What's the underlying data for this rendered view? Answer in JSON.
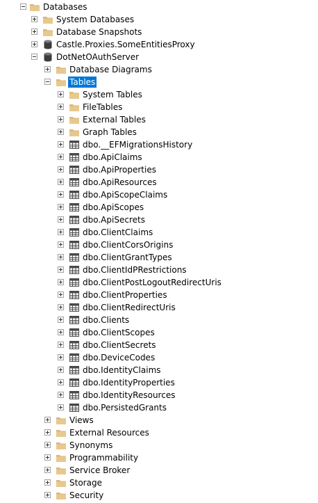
{
  "tree": {
    "databases": "Databases",
    "system_databases": "System Databases",
    "database_snapshots": "Database Snapshots",
    "db_castle": "Castle.Proxies.SomeEntitiesProxy",
    "db_dotnet": "DotNetOAuthServer",
    "diagrams": "Database Diagrams",
    "tables": "Tables",
    "system_tables": "System Tables",
    "file_tables": "FileTables",
    "external_tables": "External Tables",
    "graph_tables": "Graph Tables",
    "table_names": [
      "dbo.__EFMigrationsHistory",
      "dbo.ApiClaims",
      "dbo.ApiProperties",
      "dbo.ApiResources",
      "dbo.ApiScopeClaims",
      "dbo.ApiScopes",
      "dbo.ApiSecrets",
      "dbo.ClientClaims",
      "dbo.ClientCorsOrigins",
      "dbo.ClientGrantTypes",
      "dbo.ClientIdPRestrictions",
      "dbo.ClientPostLogoutRedirectUris",
      "dbo.ClientProperties",
      "dbo.ClientRedirectUris",
      "dbo.Clients",
      "dbo.ClientScopes",
      "dbo.ClientSecrets",
      "dbo.DeviceCodes",
      "dbo.IdentityClaims",
      "dbo.IdentityProperties",
      "dbo.IdentityResources",
      "dbo.PersistedGrants"
    ],
    "views": "Views",
    "external_resources": "External Resources",
    "synonyms": "Synonyms",
    "programmability": "Programmability",
    "service_broker": "Service Broker",
    "storage": "Storage",
    "security": "Security"
  },
  "colors": {
    "selection": "#0078d7",
    "folder": "#dcb67a",
    "database": "#3c3c3c",
    "table_grid": "#4a4a4a"
  },
  "icons": {
    "folder": "folder-icon",
    "database": "database-icon",
    "table": "table-icon"
  }
}
